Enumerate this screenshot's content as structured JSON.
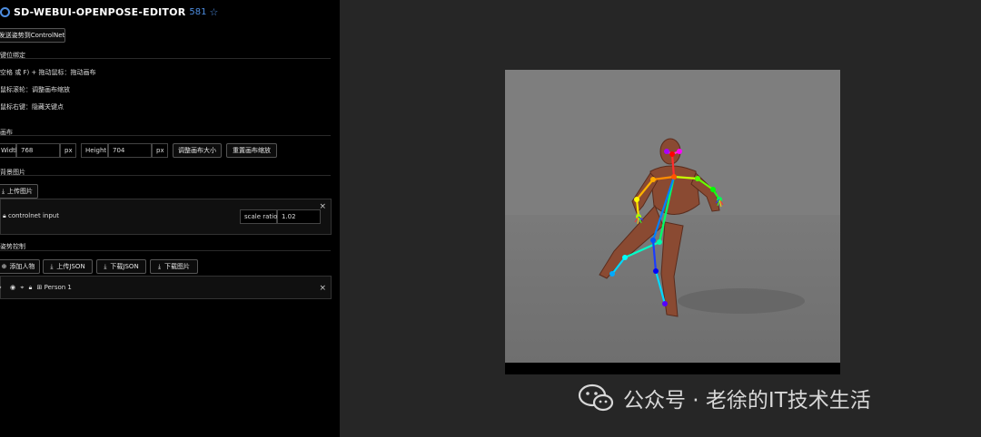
{
  "header": {
    "title": "SD-WEBUI-OPENPOSE-EDITOR",
    "stars": "581"
  },
  "send_button": "发送姿势到ControlNet",
  "keybind": {
    "title": "键位绑定",
    "lines": [
      "空格 或 F) + 拖动鼠标：拖动画布",
      "鼠标滚轮：调整画布缩放",
      "鼠标右键：隐藏关键点"
    ]
  },
  "canvas_section": {
    "title": "画布",
    "width_label": "Width",
    "width_value": "768",
    "width_unit": "px",
    "height_label": "Height",
    "height_value": "704",
    "height_unit": "px",
    "resize_button": "调整画布大小",
    "reset_zoom_button": "重置画布缩放"
  },
  "bg_section": {
    "title": "背景图片",
    "upload_button": "上传图片",
    "layer_label": "controlnet input",
    "scale_label": "scale ratio",
    "scale_value": "1.02",
    "close": "×"
  },
  "pose_section": {
    "title": "姿势控制",
    "buttons": [
      "添加人物",
      "上传JSON",
      "下载JSON",
      "下载图片"
    ],
    "person_label": "Person 1",
    "close": "×"
  },
  "watermark": "公众号 · 老徐的IT技术生活"
}
